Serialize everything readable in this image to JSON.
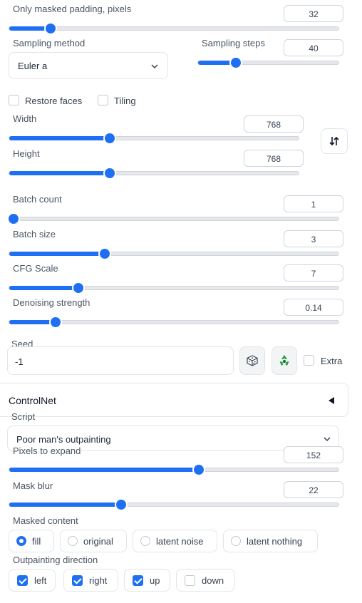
{
  "inpaint": {
    "padding_label": "Only masked padding, pixels",
    "padding_value": "32",
    "padding_level": 0.125
  },
  "sampling": {
    "method_label": "Sampling method",
    "method_value": "Euler a",
    "steps_label": "Sampling steps",
    "steps_value": "40",
    "steps_level": 0.27
  },
  "options": {
    "restore_faces": "Restore faces",
    "tiling": "Tiling"
  },
  "size": {
    "width_label": "Width",
    "width_value": "768",
    "width_level": 0.347,
    "height_label": "Height",
    "height_value": "768",
    "height_level": 0.347,
    "swap_icon": "swap-icon"
  },
  "batch": {
    "count_label": "Batch count",
    "count_value": "1",
    "count_level": 0.0,
    "size_label": "Batch size",
    "size_value": "3",
    "size_level": 0.29
  },
  "cfg": {
    "label": "CFG Scale",
    "value": "7",
    "level": 0.21
  },
  "denoise": {
    "label": "Denoising strength",
    "value": "0.14",
    "level": 0.14
  },
  "seed": {
    "label": "Seed",
    "value": "-1",
    "extra_label": "Extra"
  },
  "controlnet": {
    "title": "ControlNet"
  },
  "script": {
    "label": "Script",
    "value": "Poor man's outpainting",
    "pixels_label": "Pixels to expand",
    "pixels_value": "152",
    "pixels_level": 0.575,
    "blur_label": "Mask blur",
    "blur_value": "22",
    "blur_level": 0.34,
    "masked_label": "Masked content",
    "masked_options": [
      "fill",
      "original",
      "latent noise",
      "latent nothing"
    ],
    "masked_selected": "fill",
    "direction_label": "Outpainting direction",
    "directions": [
      "left",
      "right",
      "up",
      "down"
    ]
  },
  "colors": {
    "accent": "#1f6ff2",
    "dice_bg": "#f3f4f6",
    "recycle": "#1f9a3a"
  }
}
